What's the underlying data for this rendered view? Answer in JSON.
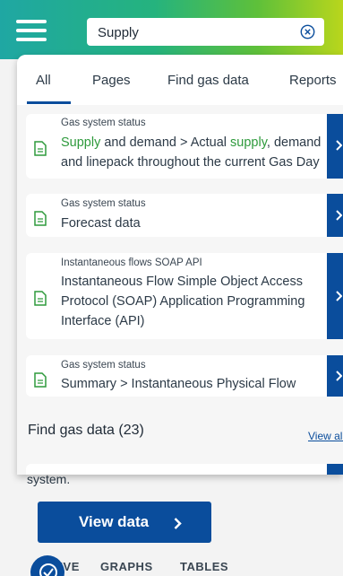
{
  "search": {
    "value": "Supply",
    "clear_icon": "clear-circle-x-icon"
  },
  "tabs": [
    {
      "label": "All"
    },
    {
      "label": "Pages"
    },
    {
      "label": "Find gas data"
    },
    {
      "label": "Reports"
    }
  ],
  "results": [
    {
      "category": "Gas system status",
      "text_hl1": "Supply",
      "text_mid": " and demand > Actual ",
      "text_hl2": "supply",
      "text_end": ", demand and linepack throughout the current Gas Day"
    },
    {
      "category": "Gas system status",
      "text": "Forecast data"
    },
    {
      "category": "Instantaneous flows SOAP API",
      "text": "Instantaneous Flow Simple Object Access Protocol (SOAP) Application Programming Interface (API)"
    },
    {
      "category": "Gas system status",
      "text": "Summary > Instantaneous Physical Flow"
    }
  ],
  "find_gas_data": {
    "title": "Find gas data (23)",
    "view_all": "View all"
  },
  "background": {
    "partial_text": "system.",
    "view_data_label": "View data",
    "bottom_tabs": [
      "LIVE",
      "GRAPHS",
      "TABLES"
    ]
  },
  "colors": {
    "brand_blue": "#0a4d9c",
    "highlight_green": "#2e9a3c"
  }
}
